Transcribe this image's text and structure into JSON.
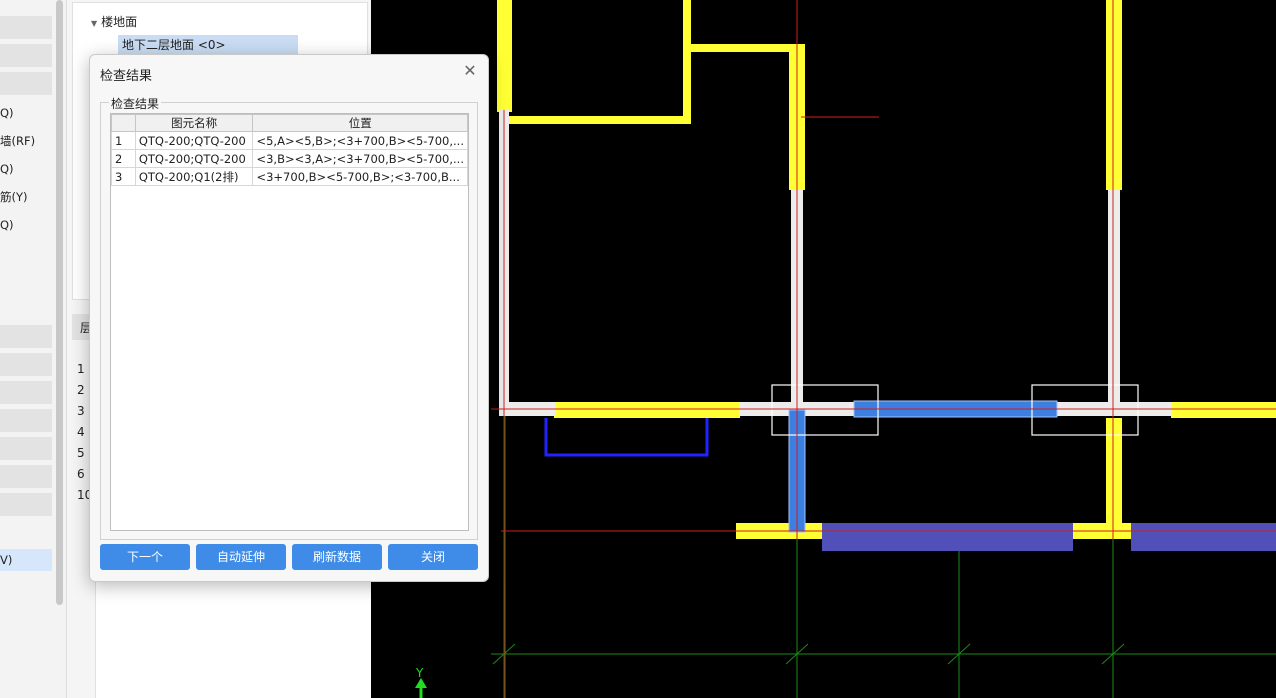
{
  "left_nav": {
    "items": [
      {
        "label": "Q)"
      },
      {
        "label": "墙(RF)"
      },
      {
        "label": "Q)"
      },
      {
        "label": "筋(Y)"
      },
      {
        "label": "Q)"
      },
      {
        "label": "V)",
        "selected": true
      }
    ]
  },
  "tree": {
    "root_label": "楼地面",
    "child_label": "地下二层地面 <0>",
    "table_header": "层",
    "row_numbers": [
      "1",
      "2",
      "3",
      "4",
      "5",
      "6",
      "10"
    ]
  },
  "dialog": {
    "title": "检查结果",
    "group_label": "检查结果",
    "columns": [
      "",
      "图元名称",
      "位置"
    ],
    "rows": [
      {
        "no": "1",
        "name": "QTQ-200;QTQ-200",
        "position": "<5,A><5,B>;<3+700,B><5-700,..."
      },
      {
        "no": "2",
        "name": "QTQ-200;QTQ-200",
        "position": "<3,B><3,A>;<3+700,B><5-700,..."
      },
      {
        "no": "3",
        "name": "QTQ-200;Q1(2排)",
        "position": "<3+700,B><5-700,B>;<3-700,B..."
      }
    ],
    "buttons": {
      "next": "下一个",
      "auto_extend": "自动延伸",
      "refresh": "刷新数据",
      "close": "关闭"
    }
  },
  "cad": {
    "axis_label": "Y",
    "colors": {
      "background": "#000000",
      "wall": "#ffff33",
      "beam": "#3d7fe0",
      "slab_strip": "#5050b8",
      "axis_line": "#cc1f1f",
      "grid_line": "#1a8a1a"
    }
  }
}
